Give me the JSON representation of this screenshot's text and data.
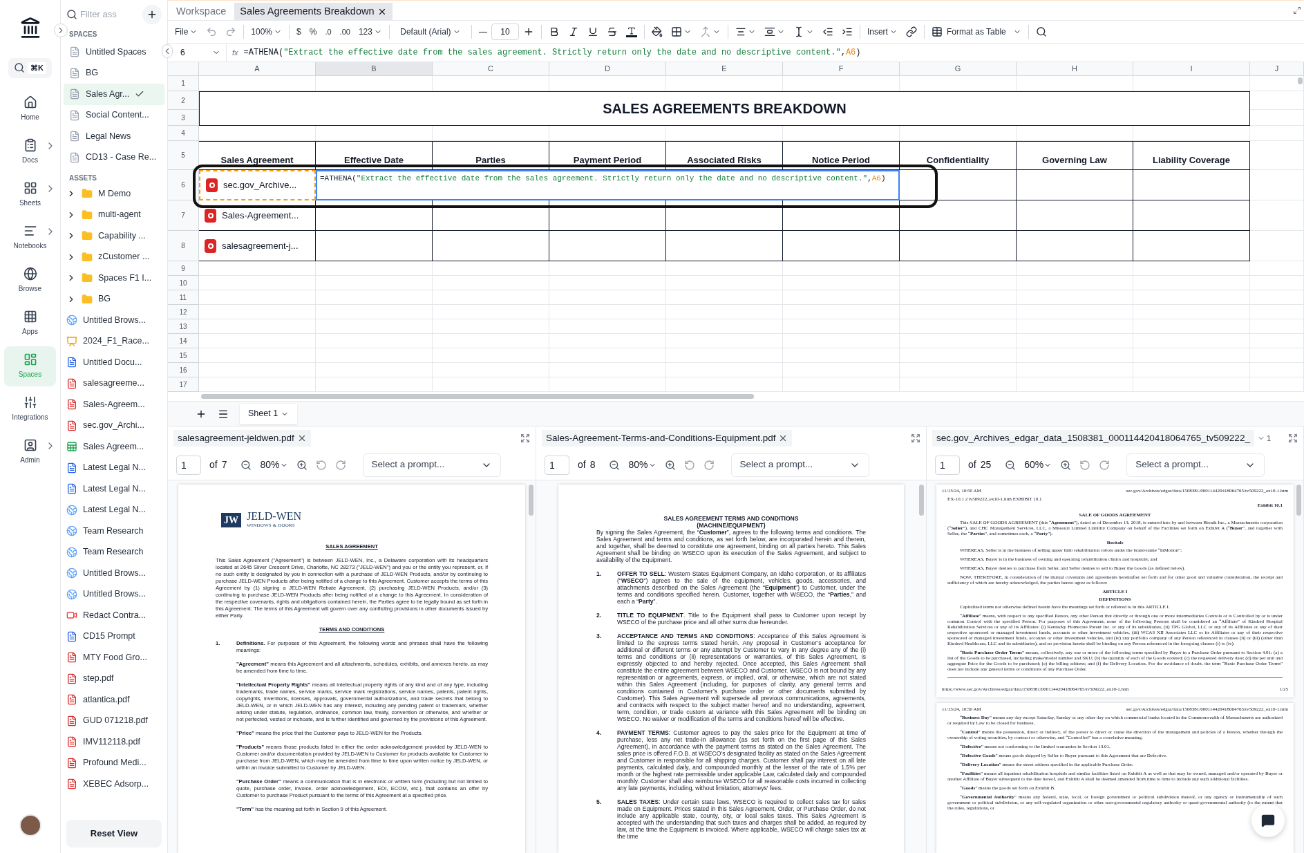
{
  "nav": {
    "search_shortcut": "⌘K",
    "items": [
      {
        "label": "Home",
        "selected": false,
        "expandable": false
      },
      {
        "label": "Docs",
        "selected": false,
        "expandable": true
      },
      {
        "label": "Sheets",
        "selected": false,
        "expandable": true
      },
      {
        "label": "Notebooks",
        "selected": false,
        "expandable": true
      },
      {
        "label": "Browse",
        "selected": false,
        "expandable": false
      },
      {
        "label": "Apps",
        "selected": false,
        "expandable": false
      },
      {
        "label": "Spaces",
        "selected": true,
        "expandable": false
      },
      {
        "label": "Integrations",
        "selected": false,
        "expandable": false
      },
      {
        "label": "Admin",
        "selected": false,
        "expandable": true
      }
    ]
  },
  "sidebar": {
    "filter_placeholder": "Filter ass",
    "spaces_label": "SPACES",
    "assets_label": "ASSETS",
    "reset_button": "Reset View",
    "spaces": [
      {
        "label": "Untitled Spaces",
        "selected": false
      },
      {
        "label": "BG",
        "selected": false
      },
      {
        "label": "Sales Agr...",
        "selected": true
      },
      {
        "label": "Social Content...",
        "selected": false
      },
      {
        "label": "Legal News",
        "selected": false
      },
      {
        "label": "CD13 - Case Re...",
        "selected": false
      }
    ],
    "assets": [
      {
        "label": "M Demo",
        "kind": "folder"
      },
      {
        "label": "multi-agent",
        "kind": "folder"
      },
      {
        "label": "Capability ...",
        "kind": "folder"
      },
      {
        "label": "zCustomer ...",
        "kind": "folder"
      },
      {
        "label": "Spaces F1 I...",
        "kind": "folder"
      },
      {
        "label": "BG",
        "kind": "folder"
      },
      {
        "label": "Untitled Brows...",
        "kind": "web"
      },
      {
        "label": "2024_F1_Race...",
        "kind": "slides"
      },
      {
        "label": "Untitled Docu...",
        "kind": "doc"
      },
      {
        "label": "salesagreeme...",
        "kind": "pdf"
      },
      {
        "label": "Sales-Agreem...",
        "kind": "pdf"
      },
      {
        "label": "sec.gov_Archi...",
        "kind": "pdf"
      },
      {
        "label": "Sales Agreem...",
        "kind": "sheet"
      },
      {
        "label": "Latest Legal N...",
        "kind": "doc"
      },
      {
        "label": "Latest Legal N...",
        "kind": "doc"
      },
      {
        "label": "Latest Legal N...",
        "kind": "web"
      },
      {
        "label": "Team Research",
        "kind": "web"
      },
      {
        "label": "Team Research",
        "kind": "web"
      },
      {
        "label": "Untitled Brows...",
        "kind": "web"
      },
      {
        "label": "Untitled Brows...",
        "kind": "web"
      },
      {
        "label": "Redact Contra...",
        "kind": "video"
      },
      {
        "label": "CD15 Prompt",
        "kind": "doc"
      },
      {
        "label": "MTY Food Gro...",
        "kind": "pdf"
      },
      {
        "label": "step.pdf",
        "kind": "pdf"
      },
      {
        "label": "atlantica.pdf",
        "kind": "pdf"
      },
      {
        "label": "GUD 071218.pdf",
        "kind": "pdf"
      },
      {
        "label": "IMV112118.pdf",
        "kind": "pdf"
      },
      {
        "label": "Profound Medi...",
        "kind": "pdf"
      },
      {
        "label": "XEBEC Adsorp...",
        "kind": "pdf"
      }
    ]
  },
  "tabs": [
    {
      "label": "Workspace",
      "selected": false
    },
    {
      "label": "Sales Agreements Breakdown",
      "selected": true
    }
  ],
  "toolbar": {
    "file": "File",
    "zoom": "100%",
    "currency": "$",
    "percent": "%",
    "dec_less": ".0",
    "dec_more": ".00",
    "number_format": "123",
    "font": "Default (Arial)",
    "font_size": "10",
    "insert": "Insert",
    "format_table": "Format as Table"
  },
  "formula_bar": {
    "cell": "6",
    "fx": "fx",
    "parts": [
      {
        "text": "=ATHENA(",
        "kind": "plain"
      },
      {
        "text": "\"Extract the effective date from the sales agreement. Strictly return only the date and no descriptive content.\"",
        "kind": "string"
      },
      {
        "text": ",",
        "kind": "plain"
      },
      {
        "text": "A6",
        "kind": "ref"
      },
      {
        "text": ")",
        "kind": "plain"
      }
    ]
  },
  "sheet": {
    "columns": [
      {
        "label": "A",
        "selected": false
      },
      {
        "label": "B",
        "selected": true
      },
      {
        "label": "C",
        "selected": false
      },
      {
        "label": "D",
        "selected": false
      },
      {
        "label": "E",
        "selected": false
      },
      {
        "label": "F",
        "selected": false
      },
      {
        "label": "G",
        "selected": false
      },
      {
        "label": "H",
        "selected": false
      },
      {
        "label": "I",
        "selected": false
      },
      {
        "label": "J",
        "selected": false
      }
    ],
    "row_numbers": [
      "1",
      "2",
      "3",
      "4",
      "5",
      "6",
      "7",
      "8",
      "9",
      "10",
      "11",
      "12",
      "13",
      "14",
      "15",
      "16",
      "17"
    ],
    "title": "SALES AGREEMENTS BREAKDOWN",
    "headers": [
      "Sales Agreement",
      "Effective Date",
      "Parties",
      "Payment Period",
      "Associated Risks",
      "Notice Period",
      "Confidentiality",
      "Governing Law",
      "Liability Coverage"
    ],
    "rows": [
      {
        "file": "sec.gov_Archive...",
        "referenced": true,
        "editor": [
          {
            "text": "=ATHENA(",
            "kind": "plain"
          },
          {
            "text": "\"Extract the effective date from the sales agreement. Strictly return only the date and no descriptive content.\"",
            "kind": "string"
          },
          {
            "text": ",",
            "kind": "plain"
          },
          {
            "text": "A6",
            "kind": "ref"
          },
          {
            "text": ")",
            "kind": "plain"
          }
        ]
      },
      {
        "file": "Sales-Agreement...",
        "referenced": false
      },
      {
        "file": "salesagreement-j...",
        "referenced": false
      }
    ],
    "sheet_tab": "Sheet 1"
  },
  "pdfs": [
    {
      "title": "salesagreement-jeldwen.pdf",
      "page": "1",
      "of": "of",
      "pages": "7",
      "zoom": "80%",
      "prompt": "Select a prompt...",
      "blocks": [
        {
          "kind": "logo",
          "mark": "JW",
          "name": "JELD-WEN",
          "tagline": "WINDOWS & DOORS"
        },
        {
          "kind": "heading_u",
          "text": "SALES AGREEMENT"
        },
        {
          "kind": "para",
          "text": "This Sales Agreement (\"Agreement\") is between JELD-WEN, Inc., a Delaware corporation with its headquarters located at 2645 Silver Crescent Drive, Charlotte, NC 28273 (\"JELD-WEN\") and you or the entity you represent, or, if no such entity is designated by you in connection with a purchase of JELD-WEN Products, and/or by continuing to purchase JELD-WEN Products after being notified of a change to this Agreement. Customer accepts the terms of this Agreement by (1) signing a JELD-WEN Rebate Agreement, (2) purchasing JELD-WEN Products, and/or (3) continuing to purchase JELD-WEN Products after being notified of a change to this Agreement. In consideration of the respective covenants, rights and obligations contained herein, the Parties agree to be legally bound as set forth in this Agreement. The terms of this Agreement will govern over any conflicting provisions in other documents issued by either Party."
        },
        {
          "kind": "heading_u",
          "text": "TERMS AND CONDITIONS"
        },
        {
          "kind": "item",
          "num": "1.",
          "text": "**Definitions.** For purposes of this Agreement, the following words and phrases shall have the following meanings:"
        },
        {
          "kind": "def",
          "text": "**\"Agreement\"** means this Agreement and all attachments, schedules, exhibits, and annexes hereto, as may be amended from time to time."
        },
        {
          "kind": "def",
          "text": "**\"Intellectual Property Rights\"** means all intellectual property rights of any kind and of any type, including trademarks, trade names, service marks, service mark registrations, service names, patents, patent rights, copyrights, inventions, licenses, approvals, governmental authorizations, and trade secrets that belong to JELD-WEN, or in which JELD-WEN has any interest, including any pending patent or trademark, whether arising under statute, regulation, ordinance, common law, treaty, convention or otherwise, and whether or not perfected, vested or inchoate, and is further identified and governed by the provisions of this Agreement."
        },
        {
          "kind": "def",
          "text": "**\"Price\"** means the price that the Customer pays to JELD-WEN for the Products."
        },
        {
          "kind": "def",
          "text": "**\"Products\"** means those products listed in either the order acknowledgement provided by JELD-WEN to Customer and/or documentation provided by JELD-WEN to Customer for products available for Customer to purchase from JELD-WEN, which may be amended from time to time upon written notice by JELD-WEN, or within an invoice submitted to Customer by JELD-WEN."
        },
        {
          "kind": "def",
          "text": "**\"Purchase Order\"** means a communication that is in electronic or written form (including but not limited to quote, purchase order, invoice, order acknowledgement, EDI, ECOM, etc.), that contains an offer by Customer to purchase Product pursuant to the terms of this Agreement at a specified price."
        },
        {
          "kind": "def",
          "text": "**\"Term\"** has the meaning set forth in Section 9 of this Agreement."
        }
      ]
    },
    {
      "title": "Sales-Agreement-Terms-and-Conditions-Equipment.pdf",
      "page": "1",
      "of": "of",
      "pages": "8",
      "zoom": "80%",
      "prompt": "Select a prompt...",
      "blocks": [
        {
          "kind": "heading",
          "text": "SALES AGREEMENT TERMS AND CONDITIONS"
        },
        {
          "kind": "heading",
          "text": "(MACHINE/EQUIPMENT)"
        },
        {
          "kind": "para",
          "text": "By signing the Sales Agreement, the “**Customer**”, agrees to the following terms and conditions. The Sales Agreement and terms and conditions, as set forth below, are incorporated herein and therein, and together, shall be deemed to constitute one agreement, binding on all parties hereto. This Sales Agreement shall be binding on WSECO upon its execution of the Sales Agreement, and subject to availability of the Equipment."
        },
        {
          "kind": "item",
          "num": "1.",
          "text": "**OFFER TO SELL**: Western States Equipment Company, an Idaho corporation, or its affiliates (\"**WSECO**\") agrees to the sale of the equipment, vehicles, goods, accessories, and attachments described on the Sales Agreement (the “**Equipment**”) to Customer, under the terms and conditions specified herein. Customer, together with WSECO, the “**Parties**,” and each a “**Party**”."
        },
        {
          "kind": "item",
          "num": "2.",
          "text": "**TITLE TO EQUIPMENT**. Title to the Equipment shall pass to Customer upon receipt by WSECO of the purchase price and all other sums due hereunder."
        },
        {
          "kind": "item",
          "num": "3.",
          "text": "**ACCEPTANCE AND TERMS AND CONDITIONS**: Acceptance of this Sales Agreement is limited to the express terms stated herein. Any proposal in Customer’s acceptance for additional or different terms or any attempt by Customer to vary in any degree any of the (i) terms and conditions or (ii) representations or warranties, of this Sales Agreement, is expressly objected to and hereby rejected. Once accepted, this Sales Agreement shall constitute the entire agreement between WSECO and Customer. WSECO is not bound by any representation or agreements, express, or implied, oral, or otherwise, which are not stated within this Sales Agreement (including, for purposes of clarity, any general terms and conditions contained in Customer’s purchase order or other documents submitted by Customer). This Sales Agreement will supersede all previous communications, agreements, and contracts with respect to the subject matter hereof and no understanding, agreement, term, condition, or trade custom at variance with this Sales Agreement will be binding on WSECO. No waiver or modification of the terms and conditions hereof will be effective."
        },
        {
          "kind": "item",
          "num": "4.",
          "text": "**PAYMENT TERMS**: Customer agrees to pay the sales price for the Equipment at time of purchase, less any net trade-in allowance (as set forth on the first page of this Sales Agreement), in accordance with the payment terms as stated on the Sales Agreement. The sales price is offered F.O.B. at WSECO’s designated facility as stated on the Sales Agreement and Customer is responsible for all shipping charges. Customer shall pay interest on all late payments, calculated daily, and compounded monthly at the lesser of the rate of 1.5% per month or the highest rate permissible under applicable Law, calculated daily and compounded monthly. Customer shall also reimburse WSECO for all reasonable costs incurred in collecting any late payments, including, without limitation, attorneys' fees."
        },
        {
          "kind": "item",
          "num": "5.",
          "text": "**SALES TAXES**: Under certain state laws, WSECO is required to collect sales tax for sales made on Equipment. Prices stated in this Sales Agreement, Order, or Purchase Order, do not include any applicable state, county, city, or local sales taxes. This Sales Agreement is accepted with the understanding that such taxes and charges shall be added, as required by law, at the time the Equipment is invoiced. Where applicable, WSECO will charge sales tax at the time"
        }
      ]
    },
    {
      "title": "sec.gov_Archives_edgar_data_1508381_000114420418064765_tv509222_",
      "page": "1",
      "of": "of",
      "pages": "25",
      "zoom": "60%",
      "prompt": "Select a prompt...",
      "count": "1",
      "blocks": [
        {
          "kind": "meta",
          "left": "11/13/24, 10:50 AM",
          "right": "sec.gov/Archives/edgar/data/1508381/000114420418064765/tv509222_ex10-1.htm"
        },
        {
          "kind": "line",
          "text": "EX-10.1 2 tv509222_ex10-1.htm EXHIBIT 10.1"
        },
        {
          "kind": "right",
          "text": "Exhibit 10.1"
        },
        {
          "kind": "heading",
          "text": "SALE OF GOODS AGREEMENT"
        },
        {
          "kind": "para",
          "text": "This SALE OF GOODS AGREEMENT (this “**Agreement**”), dated as of December 13, 2018, is entered into by and between Bionik Inc., a Massachusetts corporation (“**Seller**”), and CHC Management Services, LLC, a Missouri Limited Liability Company on behalf of the Facilities set forth on Exhibit A (“**Buyer**”, and together with Seller, the “**Parties**”, and sometimes each, a “**Party**”)."
        },
        {
          "kind": "heading",
          "text": "Recitals"
        },
        {
          "kind": "para",
          "text": "WHEREAS, Seller is in the business of selling upper limb rehabilitation robots under the brand-name “InMotion”;"
        },
        {
          "kind": "para",
          "text": "WHEREAS, Buyer is in the business of owning and operating rehabilitation clinics and hospitals; and"
        },
        {
          "kind": "para",
          "text": "WHEREAS, Buyer desires to purchase from Seller, and Seller desires to sell to Buyer the Goods (as defined below)."
        },
        {
          "kind": "para",
          "text": "NOW, THEREFORE, in consideration of the mutual covenants and agreements hereinafter set forth and for other good and valuable consideration, the receipt and sufficiency of which are hereby acknowledged, the parties hereto agree as follows:"
        },
        {
          "kind": "heading",
          "text": "ARTICLE I"
        },
        {
          "kind": "heading",
          "text": "DEFINITIONS"
        },
        {
          "kind": "para",
          "text": "Capitalized terms not otherwise defined herein have the meanings set forth or referred to in this ARTICLE I."
        },
        {
          "kind": "para",
          "text": "“**Affiliate**” means, with respect to any specified Person, any other Person that directly or through one or more intermediaries Controls or is Controlled by or is under common Control with the specified Person. For purposes of this Agreement, none of the following Persons shall be considered an “Affiliate” of Kindred Hospital Rehabilitation Services or any of its Affiliates: (i) Kentucky Homecare Parent Inc. or any of its subsidiaries, (ii) TPG Global, LLC or any of its Affiliates or any of their respective sponsored or managed investment funds, accounts or other investment vehicles, (iii) WCAS XII Associates LLC or its Affiliates or any of their respective sponsored or managed investment funds, accounts or other investment vehicles, and (iv) any portfolio company of any Person referenced in clauses (ii) or (iii) (other than Kindred Healthcare, LLC and its subsidiaries), and no provision herein shall be binding on any Person referenced in the foregoing clauses (i) to (iv)."
        },
        {
          "kind": "para",
          "text": "“**Basic Purchase Order Terms**” means, collectively, any one or more of the following terms specified by Buyer in a Purchase Order pursuant to Section 4.01: (a) a list of the Goods to be purchased, including make/model number and SKU; (b) the quantity of each of the Goods ordered; (c) the requested delivery date; (d) the per unit and aggregate Price for the Goods to be purchased; (e) the billing address; and (f) the Delivery Location. For the avoidance of doubt, the term “Basic Purchase Order Terms” does not include any general terms or conditions of any Purchase Order."
        },
        {
          "kind": "rule"
        },
        {
          "kind": "meta",
          "left": "https://www.sec.gov/Archives/edgar/data/1508381/000114420418064765/tv509222_ex10-1.htm",
          "right": "1/25"
        },
        {
          "kind": "pagebreak"
        },
        {
          "kind": "meta",
          "left": "11/13/24, 10:50 AM",
          "right": "sec.gov/Archives/edgar/data/1508381/000114420418064765/tv509222_ex10-1.htm"
        },
        {
          "kind": "para",
          "text": "“**Business Day**” means any day except Saturday, Sunday or any other day on which commercial banks located in the Commonwealth of Massachusetts are authorized or required by Law to be closed for business."
        },
        {
          "kind": "para",
          "text": "“**Control**” means the possession, direct or indirect, of the power to direct or cause the direction of the management and policies of a Person, whether through the ownership of voting securities, by contract or otherwise, and “Controlled” has a correlative meaning."
        },
        {
          "kind": "para",
          "text": "“**Defective**” means not conforming to the limited warranties in Section 13.01."
        },
        {
          "kind": "para",
          "text": "“**Defective Goods**” means goods shipped by Seller to Buyer pursuant to this Agreement that are Defective."
        },
        {
          "kind": "para",
          "text": "“**Delivery Location**” means the street address specified in the applicable Purchase Order."
        },
        {
          "kind": "para",
          "text": "“**Facilities**” means all inpatient rehabilitation hospitals and similar facilities listed on Exhibit A as well as that may be owned, managed and/or operated by Buyer or another Affiliate of Buyer subsequent to the date hereof, and Exhibit A shall be deemed amended from time to time to include any such additional facilities."
        },
        {
          "kind": "para",
          "text": "“**Goods**” means the goods set forth on Exhibit B."
        },
        {
          "kind": "para",
          "text": "“**Governmental Authority**” means any federal, state, local, or foreign government or political subdivision thereof, or any agency or instrumentality of such government or political subdivision, or any self-regulated organization or other non-governmental regulatory authority or quasi-governmental authority (to the extent that the rules, regulations, or"
        }
      ]
    }
  ]
}
